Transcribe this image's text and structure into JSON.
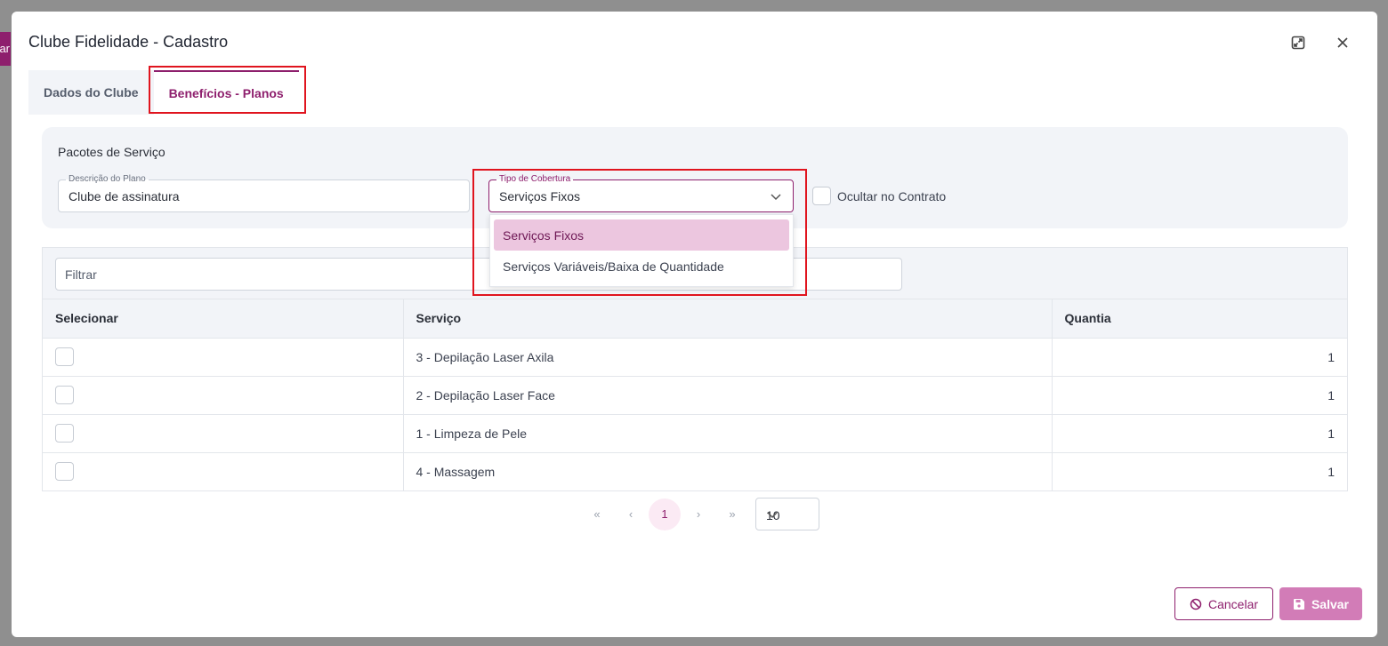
{
  "background": {
    "side_button_fragment": "ar"
  },
  "modal": {
    "title": "Clube Fidelidade - Cadastro",
    "expand_icon": "expand-icon",
    "close_icon": "close-icon"
  },
  "tabs": [
    {
      "label": "Dados do Clube",
      "active": false
    },
    {
      "label": "Benefícios - Planos",
      "active": true
    }
  ],
  "panel": {
    "title": "Pacotes de Serviço",
    "plan_description": {
      "legend": "Descrição do Plano",
      "value": "Clube de assinatura"
    },
    "coverage_type": {
      "legend": "Tipo de Cobertura",
      "value": "Serviços Fixos",
      "options": [
        {
          "label": "Serviços Fixos",
          "selected": true
        },
        {
          "label": "Serviços Variáveis/Baixa de Quantidade",
          "selected": false
        }
      ]
    },
    "hide_in_contract": {
      "label": "Ocultar no Contrato",
      "checked": false
    }
  },
  "table": {
    "filter_placeholder": "Filtrar",
    "columns": [
      "Selecionar",
      "Serviço",
      "Quantia"
    ],
    "rows": [
      {
        "service": "3 - Depilação Laser Axila",
        "quantity": "1"
      },
      {
        "service": "2 - Depilação Laser Face",
        "quantity": "1"
      },
      {
        "service": "1 - Limpeza de Pele",
        "quantity": "1"
      },
      {
        "service": "4 - Massagem",
        "quantity": "1"
      }
    ]
  },
  "pagination": {
    "first": "«",
    "prev": "‹",
    "current_page": "1",
    "next": "›",
    "last": "»",
    "page_size": "10"
  },
  "footer": {
    "cancel_label": "Cancelar",
    "save_label": "Salvar"
  },
  "colors": {
    "accent": "#8e1f6d",
    "accent_light": "#d27cb7",
    "highlight": "#e0141e",
    "panel_bg": "#f2f4f8"
  }
}
